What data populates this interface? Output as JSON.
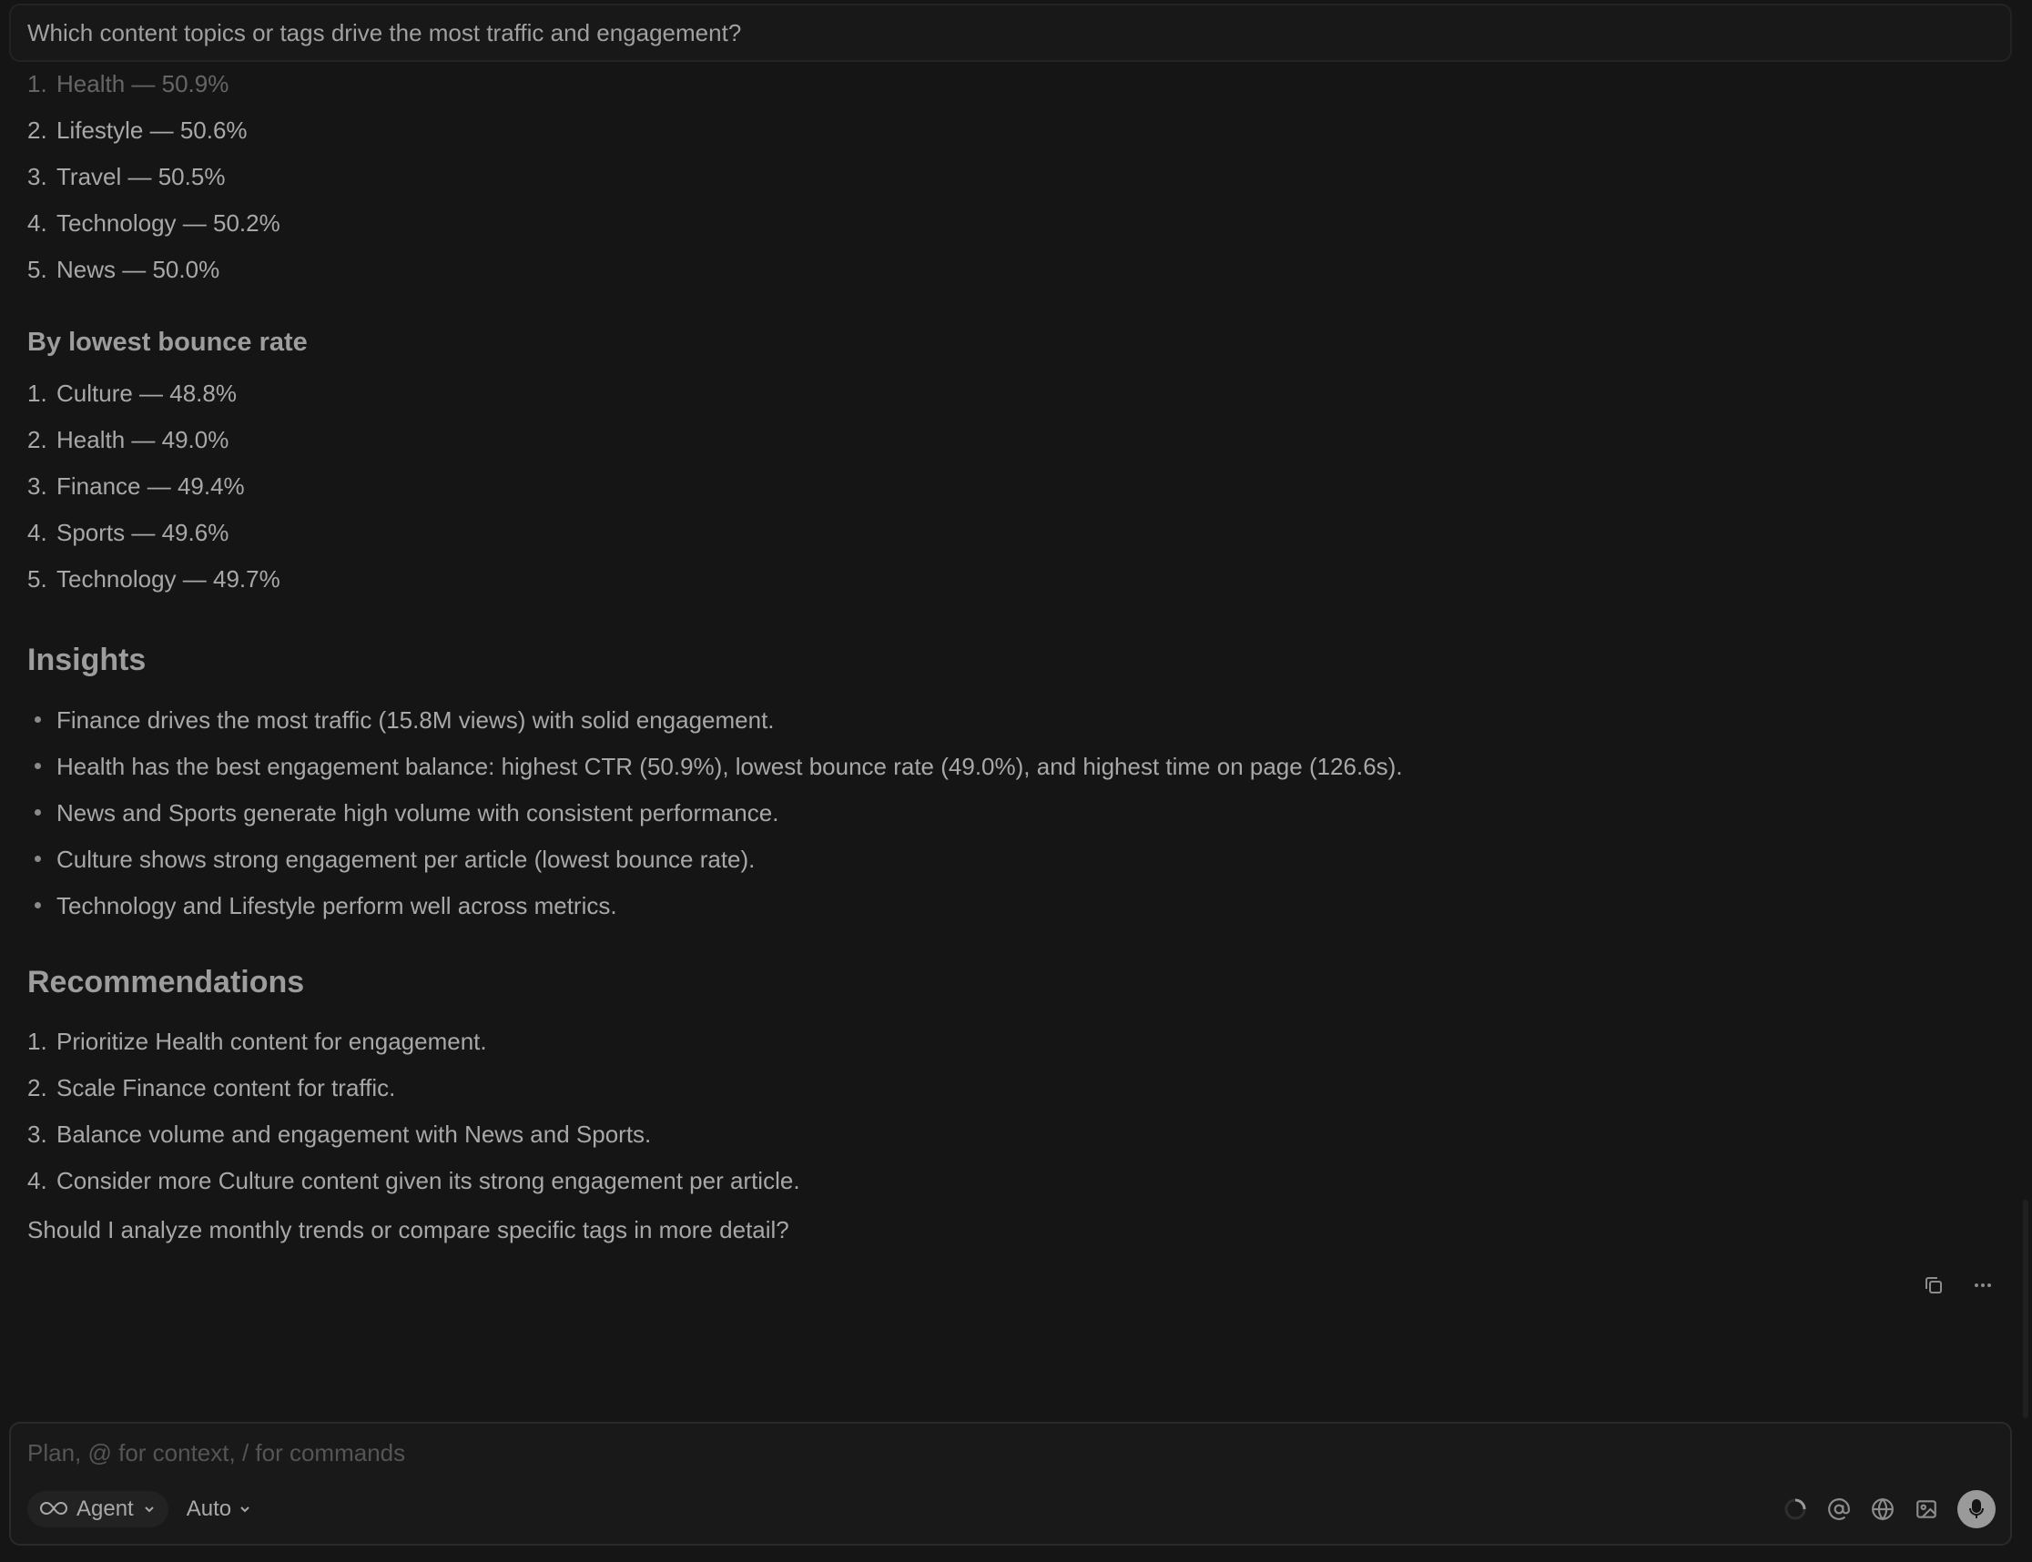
{
  "query": "Which content topics or tags drive the most traffic and engagement?",
  "ctr_list": [
    {
      "n": "1.",
      "text": "Health — 50.9%"
    },
    {
      "n": "2.",
      "text": "Lifestyle — 50.6%"
    },
    {
      "n": "3.",
      "text": "Travel — 50.5%"
    },
    {
      "n": "4.",
      "text": "Technology — 50.2%"
    },
    {
      "n": "5.",
      "text": "News — 50.0%"
    }
  ],
  "bounce": {
    "heading": "By lowest bounce rate",
    "items": [
      {
        "n": "1.",
        "text": "Culture — 48.8%"
      },
      {
        "n": "2.",
        "text": "Health — 49.0%"
      },
      {
        "n": "3.",
        "text": "Finance — 49.4%"
      },
      {
        "n": "4.",
        "text": "Sports — 49.6%"
      },
      {
        "n": "5.",
        "text": "Technology — 49.7%"
      }
    ]
  },
  "insights": {
    "heading": "Insights",
    "items": [
      "Finance drives the most traffic (15.8M views) with solid engagement.",
      "Health has the best engagement balance: highest CTR (50.9%), lowest bounce rate (49.0%), and highest time on page (126.6s).",
      "News and Sports generate high volume with consistent performance.",
      "Culture shows strong engagement per article (lowest bounce rate).",
      "Technology and Lifestyle perform well across metrics."
    ]
  },
  "recommendations": {
    "heading": "Recommendations",
    "items": [
      {
        "n": "1.",
        "text": "Prioritize Health content for engagement."
      },
      {
        "n": "2.",
        "text": "Scale Finance content for traffic."
      },
      {
        "n": "3.",
        "text": "Balance volume and engagement with News and Sports."
      },
      {
        "n": "4.",
        "text": "Consider more Culture content given its strong engagement per article."
      }
    ]
  },
  "followup": "Should I analyze monthly trends or compare specific tags in more detail?",
  "composer": {
    "placeholder": "Plan, @ for context, / for commands",
    "value": "",
    "mode_label": "Agent",
    "model_label": "Auto"
  },
  "icons": {
    "copy": "copy-icon",
    "more": "more-icon",
    "infinity": "infinity-icon",
    "chevron": "chevron-down-icon",
    "spinner": "loading-spinner-icon",
    "at": "at-mention-icon",
    "globe": "globe-icon",
    "image": "image-icon",
    "mic": "microphone-icon"
  }
}
